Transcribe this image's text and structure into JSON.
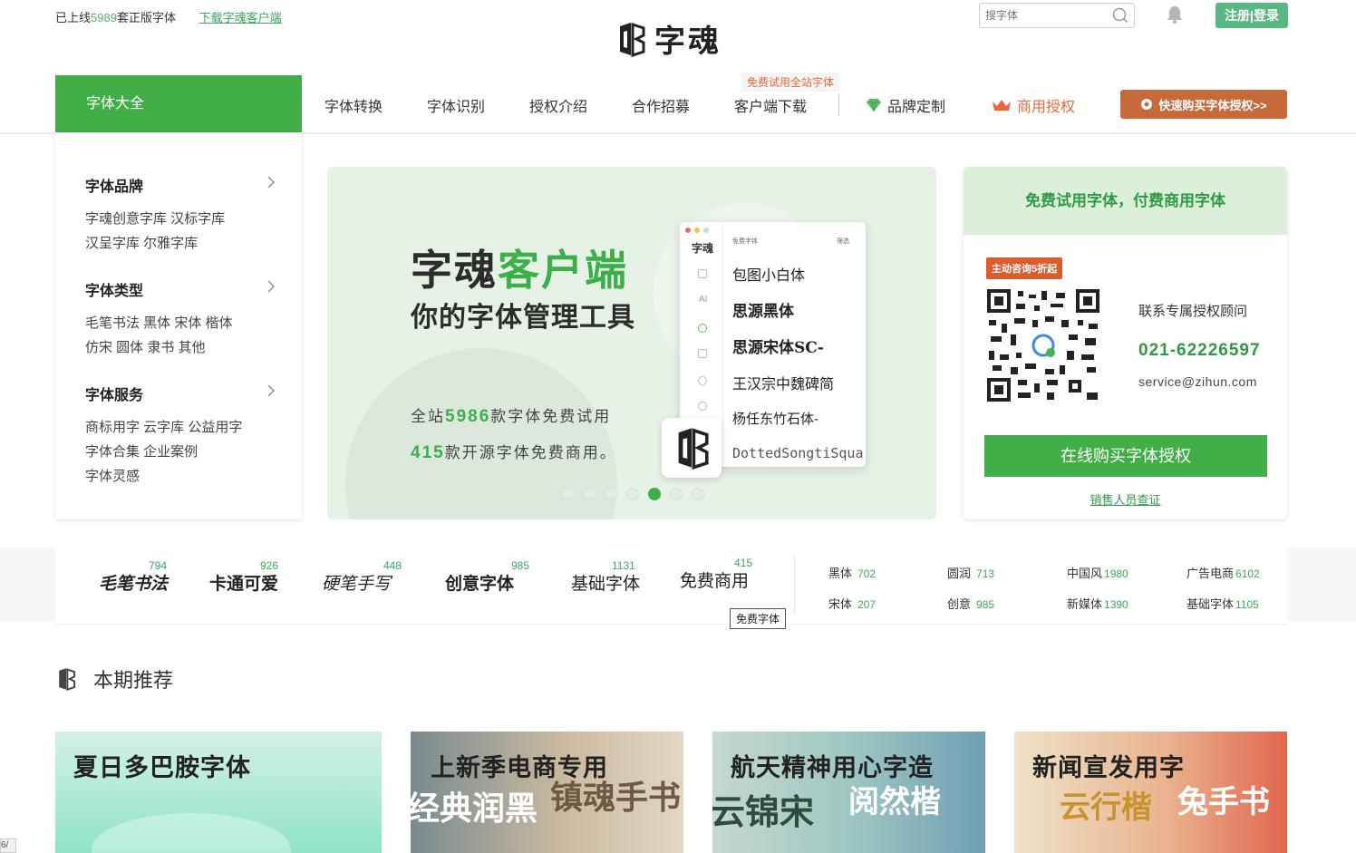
{
  "topbar": {
    "online_prefix": "已上线",
    "online_count": "5989",
    "online_suffix": "套正版字体",
    "download_link": "下载字魂客户端",
    "logo_text": "字魂",
    "search_placeholder": "搜字体",
    "register_login": "注册|登录"
  },
  "nav": {
    "main": "字体大全",
    "items": [
      "字体转换",
      "字体识别",
      "授权介绍",
      "合作招募",
      "客户端下载"
    ],
    "client_tag": "免费试用全站字体",
    "brand": "品牌定制",
    "business": "商用授权",
    "buy_button": "快速购买字体授权>>"
  },
  "sidebar": {
    "sections": [
      {
        "title": "字体品牌",
        "lines": [
          "字魂创意字库 汉标字库",
          "汉呈字库 尔雅字库"
        ]
      },
      {
        "title": "字体类型",
        "lines": [
          "毛笔书法 黑体 宋体 楷体",
          "仿宋 圆体 隶书 其他"
        ]
      },
      {
        "title": "字体服务",
        "lines": [
          "商标用字 云字库 公益用字",
          "字体合集 企业案例",
          "字体灵感"
        ]
      }
    ]
  },
  "banner": {
    "title_a": "字魂",
    "title_b": "客户端",
    "subtitle": "你的字体管理工具",
    "line1_a": "全站",
    "line1_num": "5986",
    "line1_b": "款字体免费试用",
    "line2_num": "415",
    "line2_b": "款开源字体免费商用。",
    "app": {
      "logo": "字魂",
      "tab": "免费字体",
      "filter": "筛选",
      "side_ai": "AI",
      "fonts": [
        "包图小白体",
        "思源黑体",
        "思源宋体SC-",
        "王汉宗中魏碑简",
        "杨任东竹石体-",
        "DottedSongtiSquar"
      ]
    },
    "active_dot": 4,
    "dot_count": 7
  },
  "card": {
    "header": "免费试用字体，付费商用字体",
    "tag": "主动咨询5折起",
    "consult": "联系专属授权顾问",
    "phone": "021-62226597",
    "email": "service@zihun.com",
    "button": "在线购买字体授权",
    "verify": "销售人员查证"
  },
  "categories": [
    {
      "name": "毛笔书法",
      "count": "794"
    },
    {
      "name": "卡通可爱",
      "count": "926"
    },
    {
      "name": "硬笔手写",
      "count": "448"
    },
    {
      "name": "创意字体",
      "count": "985"
    },
    {
      "name": "基础字体",
      "count": "1131"
    },
    {
      "name": "免费商用",
      "count": "415"
    }
  ],
  "mini_categories": [
    {
      "name": "黑体",
      "count": "702"
    },
    {
      "name": "圆润",
      "count": "713"
    },
    {
      "name": "中国风",
      "count": "1980"
    },
    {
      "name": "广告电商",
      "count": "6102"
    },
    {
      "name": "宋体",
      "count": "207"
    },
    {
      "name": "创意",
      "count": "985"
    },
    {
      "name": "新媒体",
      "count": "1390"
    },
    {
      "name": "基础字体",
      "count": "1105"
    }
  ],
  "tooltip": "免费字体",
  "recommend": {
    "title": "本期推荐",
    "cards": [
      "夏日多巴胺字体",
      "上新季电商专用",
      "航天精神用心字造",
      "新闻宣发用字"
    ],
    "card_art": [
      "经典润黑",
      "镇魂手书",
      "云锦宋",
      "阅然楷",
      "云行楷",
      "兔手书"
    ]
  },
  "colors": {
    "brand_green": "#42ae48",
    "accent_orange": "#e8673a",
    "buy_brown": "#c66a3a"
  },
  "side_tab": "6/"
}
